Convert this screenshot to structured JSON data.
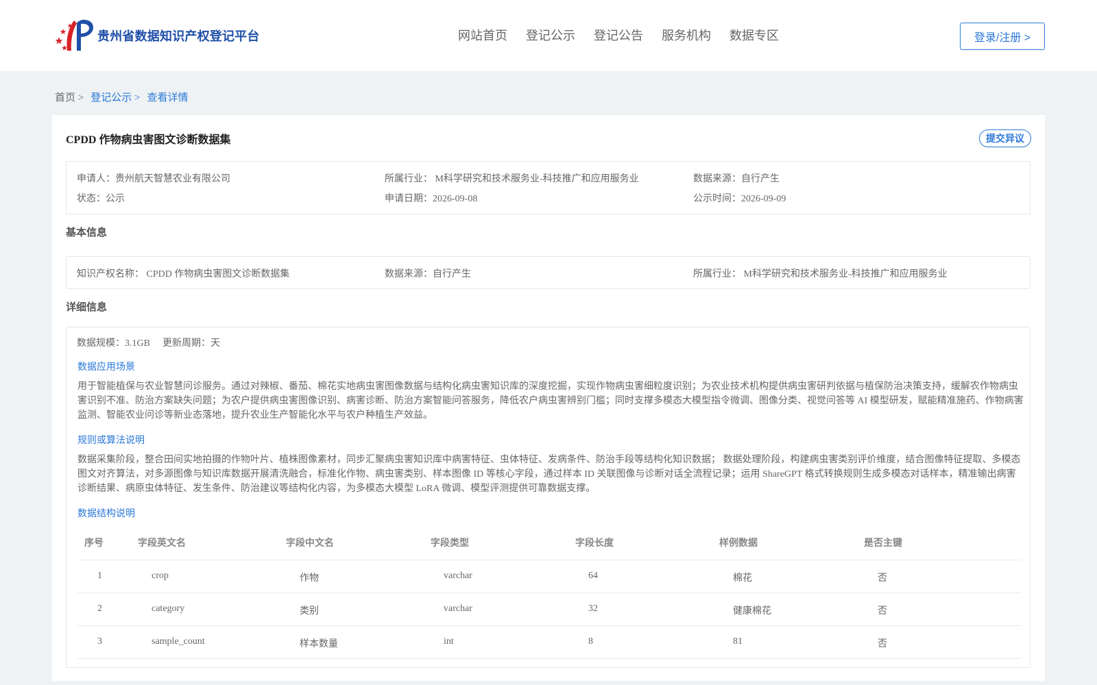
{
  "header": {
    "platform_name": "贵州省数据知识产权登记平台",
    "nav": [
      "网站首页",
      "登记公示",
      "登记公告",
      "服务机构",
      "数据专区"
    ],
    "login_label": "登录/注册 >"
  },
  "breadcrumb": [
    "首页 >",
    "登记公示 >",
    "查看详情"
  ],
  "dataset": {
    "title": "CPDD 作物病虫害图文诊断数据集",
    "objection_label": "提交异议"
  },
  "summary": {
    "applicant": "申请人：贵州航天智慧农业有限公司",
    "industry": "所属行业： M科学研究和技术服务业-科技推广和应用服务业",
    "source": "数据来源：自行产生",
    "status": "状态：公示",
    "apply_date": "申请日期：2026-09-08",
    "publish_date": "公示时间：2026-09-09"
  },
  "basic": {
    "heading": "基本信息",
    "ip_name": "知识产权名称： CPDD 作物病虫害图文诊断数据集",
    "source": "数据来源：自行产生",
    "industry": "所属行业： M科学研究和技术服务业-科技推广和应用服务业"
  },
  "detail": {
    "heading": "详细信息",
    "scale": "数据规模：3.1GB",
    "update_cycle": "更新周期：天",
    "scenario_title": "数据应用场景",
    "scenario_text": "用于智能植保与农业智慧问诊服务。通过对辣椒、番茄、棉花实地病虫害图像数据与结构化病虫害知识库的深度挖掘，实现作物病虫害细粒度识别；为农业技术机构提供病虫害研判依据与植保防治决策支持，缓解农作物病虫害识别不准、防治方案缺失问题；为农户提供病虫害图像识别、病害诊断、防治方案智能问答服务，降低农户病虫害辨别门槛；同时支撑多模态大模型指令微调、图像分类、视觉问答等 AI 模型研发，赋能精准施药、作物病害监测、智能农业问诊等新业态落地，提升农业生产智能化水平与农户种植生产效益。",
    "rules_title": "规则或算法说明",
    "rules_text": "数据采集阶段，整合田间实地拍摄的作物叶片、植株图像素材，同步汇聚病虫害知识库中病害特征、虫体特征、发病条件、防治手段等结构化知识数据； 数据处理阶段，构建病虫害类别评价维度，结合图像特征提取、多模态图文对齐算法，对多源图像与知识库数据开展清洗融合，标准化作物、病虫害类别、样本图像 ID 等核心字段，通过样本 ID 关联图像与诊断对话全流程记录；运用 ShareGPT 格式转换规则生成多模态对话样本，精准输出病害诊断结果、病原虫体特征、发生条件、防治建议等结构化内容，为多模态大模型 LoRA 微调、模型评测提供可靠数据支撑。",
    "structure_title": "数据结构说明",
    "table": {
      "headers": [
        "序号",
        "字段英文名",
        "字段中文名",
        "字段类型",
        "字段长度",
        "样例数据",
        "是否主键"
      ],
      "rows": [
        [
          "1",
          "crop",
          "作物",
          "varchar",
          "64",
          "棉花",
          "否"
        ],
        [
          "2",
          "category",
          "类别",
          "varchar",
          "32",
          "健康棉花",
          "否"
        ],
        [
          "3",
          "sample_count",
          "样本数量",
          "int",
          "8",
          "81",
          "否"
        ]
      ]
    }
  }
}
